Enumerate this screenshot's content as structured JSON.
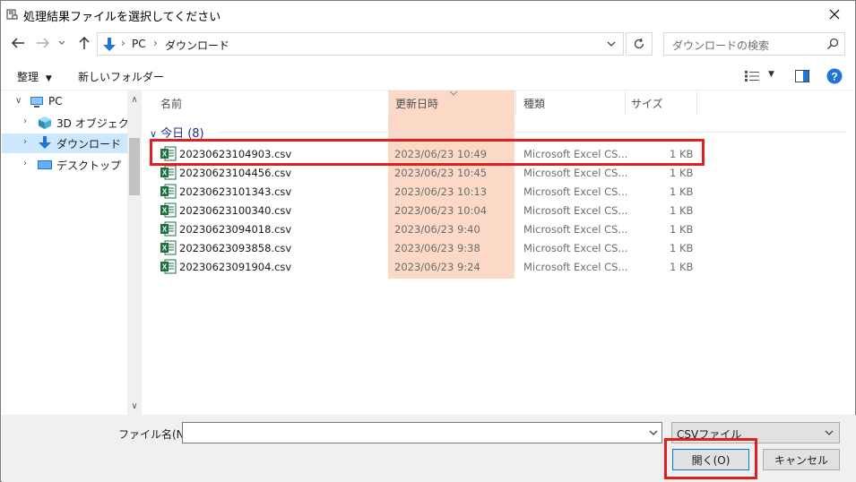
{
  "window": {
    "title": "処理結果ファイルを選択してください"
  },
  "address": {
    "crumbs": [
      "PC",
      "ダウンロード"
    ],
    "search_placeholder": "ダウンロードの検索"
  },
  "toolbar": {
    "organize_label": "整理",
    "new_folder_label": "新しいフォルダー"
  },
  "nav_tree": {
    "items": [
      {
        "label": "PC",
        "icon": "pc-icon"
      },
      {
        "label": "3D オブジェクト",
        "icon": "3d-objects-icon"
      },
      {
        "label": "ダウンロード",
        "icon": "download-icon"
      },
      {
        "label": "デスクトップ",
        "icon": "desktop-icon"
      }
    ]
  },
  "columns": {
    "name": "名前",
    "date": "更新日時",
    "type": "種類",
    "size": "サイズ"
  },
  "group": {
    "label": "今日 (8)"
  },
  "files": [
    {
      "name": "20230623104903.csv",
      "date": "2023/06/23 10:49",
      "type": "Microsoft Excel CS...",
      "size": "1 KB"
    },
    {
      "name": "20230623104456.csv",
      "date": "2023/06/23 10:45",
      "type": "Microsoft Excel CS...",
      "size": "1 KB"
    },
    {
      "name": "20230623101343.csv",
      "date": "2023/06/23 10:13",
      "type": "Microsoft Excel CS...",
      "size": "1 KB"
    },
    {
      "name": "20230623100340.csv",
      "date": "2023/06/23 10:04",
      "type": "Microsoft Excel CS...",
      "size": "1 KB"
    },
    {
      "name": "20230623094018.csv",
      "date": "2023/06/23 9:40",
      "type": "Microsoft Excel CS...",
      "size": "1 KB"
    },
    {
      "name": "20230623093858.csv",
      "date": "2023/06/23 9:38",
      "type": "Microsoft Excel CS...",
      "size": "1 KB"
    },
    {
      "name": "20230623091904.csv",
      "date": "2023/06/23 9:24",
      "type": "Microsoft Excel CS...",
      "size": "1 KB"
    }
  ],
  "footer": {
    "filename_label": "ファイル名(N):",
    "filename_value": "",
    "filter_value": "CSVファイル",
    "open_label": "開く(O)",
    "cancel_label": "キャンセル"
  },
  "colors": {
    "highlight_column": "#fbd9c6",
    "annotation_red": "#e02020",
    "selection_blue": "#cce8ff",
    "group_text": "#1e3287"
  }
}
